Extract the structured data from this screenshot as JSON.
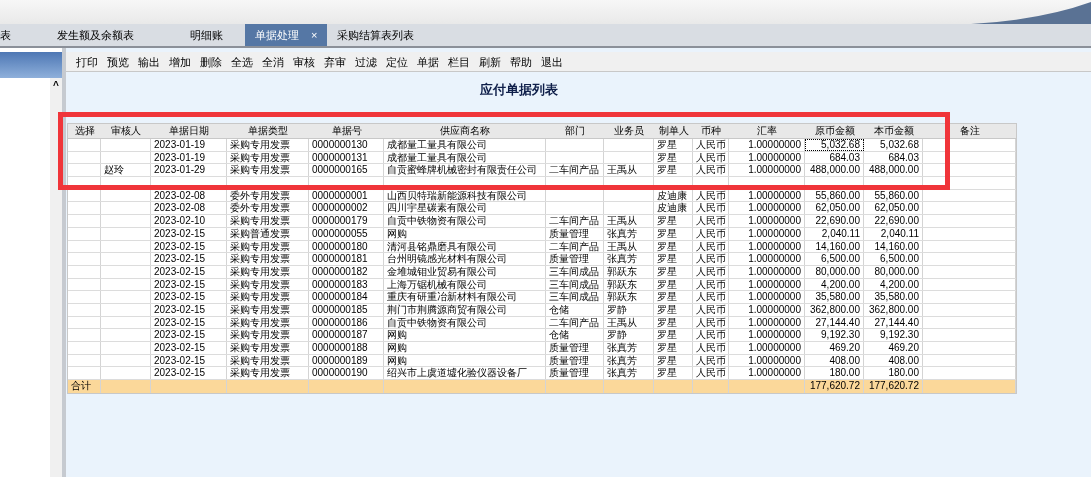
{
  "tabs": [
    {
      "label": "表",
      "selected": false,
      "closable": false
    },
    {
      "label": "发生额及余额表",
      "selected": false,
      "closable": false
    },
    {
      "label": "明细账",
      "selected": false,
      "closable": false
    },
    {
      "label": "单据处理",
      "selected": true,
      "closable": true,
      "close": "×"
    },
    {
      "label": "采购结算表列表",
      "selected": false,
      "closable": false
    }
  ],
  "sidebar": {
    "scroll_up": "^"
  },
  "toolbar": [
    "打印",
    "预览",
    "输出",
    "增加",
    "删除",
    "全选",
    "全消",
    "审核",
    "弃审",
    "过滤",
    "定位",
    "单据",
    "栏目",
    "刷新",
    "帮助",
    "退出"
  ],
  "title": "应付单据列表",
  "table": {
    "columns": [
      "选择",
      "审核人",
      "单据日期",
      "单据类型",
      "单据号",
      "供应商名称",
      "部门",
      "业务员",
      "制单人",
      "币种",
      "汇率",
      "原币金额",
      "本币金额",
      "备注"
    ],
    "rows": [
      {
        "date": "2023-01-19",
        "type": "采购专用发票",
        "number": "0000000130",
        "supplier": "成都量工量具有限公司",
        "creator": "罗星",
        "currency": "人民币",
        "rate": "1.00000000",
        "amount": "5,032.68",
        "local_amount": "5,032.68",
        "focused": true
      },
      {
        "date": "2023-01-19",
        "type": "采购专用发票",
        "number": "0000000131",
        "supplier": "成都量工量具有限公司",
        "creator": "罗星",
        "currency": "人民币",
        "rate": "1.00000000",
        "amount": "684.03",
        "local_amount": "684.03",
        "focused": false
      },
      {
        "reviewer": "赵玲",
        "date": "2023-01-29",
        "type": "采购专用发票",
        "number": "0000000165",
        "supplier": "自贡蜜蜂牌机械密封有限责任公司",
        "department": "二车间产品",
        "salesperson": "王禹从",
        "creator": "罗星",
        "currency": "人民币",
        "rate": "1.00000000",
        "amount": "488,000.00",
        "local_amount": "488,000.00",
        "focused": false
      },
      {
        "focused": false
      },
      {
        "date": "2023-02-08",
        "type": "委外专用发票",
        "number": "0000000001",
        "supplier": "山西贝特瑞新能源科技有限公司",
        "creator": "皮迪康",
        "currency": "人民币",
        "rate": "1.00000000",
        "amount": "55,860.00",
        "local_amount": "55,860.00",
        "focused": false
      },
      {
        "date": "2023-02-08",
        "type": "委外专用发票",
        "number": "0000000002",
        "supplier": "四川宇星碳素有限公司",
        "creator": "皮迪康",
        "currency": "人民币",
        "rate": "1.00000000",
        "amount": "62,050.00",
        "local_amount": "62,050.00",
        "focused": false
      },
      {
        "date": "2023-02-10",
        "type": "采购专用发票",
        "number": "0000000179",
        "supplier": "自贡中铁物资有限公司",
        "department": "二车间产品",
        "salesperson": "王禹从",
        "creator": "罗星",
        "currency": "人民币",
        "rate": "1.00000000",
        "amount": "22,690.00",
        "local_amount": "22,690.00",
        "focused": false
      },
      {
        "date": "2023-02-15",
        "type": "采购普通发票",
        "number": "0000000055",
        "supplier": "网购",
        "department": "质量管理",
        "salesperson": "张真芳",
        "creator": "罗星",
        "currency": "人民币",
        "rate": "1.00000000",
        "amount": "2,040.11",
        "local_amount": "2,040.11",
        "focused": false
      },
      {
        "date": "2023-02-15",
        "type": "采购专用发票",
        "number": "0000000180",
        "supplier": "清河县铭鼎磨具有限公司",
        "department": "二车间产品",
        "salesperson": "王禹从",
        "creator": "罗星",
        "currency": "人民币",
        "rate": "1.00000000",
        "amount": "14,160.00",
        "local_amount": "14,160.00",
        "focused": false
      },
      {
        "date": "2023-02-15",
        "type": "采购专用发票",
        "number": "0000000181",
        "supplier": "台州明镜感光材料有限公司",
        "department": "质量管理",
        "salesperson": "张真芳",
        "creator": "罗星",
        "currency": "人民币",
        "rate": "1.00000000",
        "amount": "6,500.00",
        "local_amount": "6,500.00",
        "focused": false
      },
      {
        "date": "2023-02-15",
        "type": "采购专用发票",
        "number": "0000000182",
        "supplier": "金堆城钼业贸易有限公司",
        "department": "三车间成品",
        "salesperson": "郭跃东",
        "creator": "罗星",
        "currency": "人民币",
        "rate": "1.00000000",
        "amount": "80,000.00",
        "local_amount": "80,000.00",
        "focused": false
      },
      {
        "date": "2023-02-15",
        "type": "采购专用发票",
        "number": "0000000183",
        "supplier": "上海万锯机械有限公司",
        "department": "三车间成品",
        "salesperson": "郭跃东",
        "creator": "罗星",
        "currency": "人民币",
        "rate": "1.00000000",
        "amount": "4,200.00",
        "local_amount": "4,200.00",
        "focused": false
      },
      {
        "date": "2023-02-15",
        "type": "采购专用发票",
        "number": "0000000184",
        "supplier": "重庆有研重冶新材料有限公司",
        "department": "三车间成品",
        "salesperson": "郭跃东",
        "creator": "罗星",
        "currency": "人民币",
        "rate": "1.00000000",
        "amount": "35,580.00",
        "local_amount": "35,580.00",
        "focused": false
      },
      {
        "date": "2023-02-15",
        "type": "采购专用发票",
        "number": "0000000185",
        "supplier": "荆门市荆腾源商贸有限公司",
        "department": "仓储",
        "salesperson": "罗静",
        "creator": "罗星",
        "currency": "人民币",
        "rate": "1.00000000",
        "amount": "362,800.00",
        "local_amount": "362,800.00",
        "focused": false
      },
      {
        "date": "2023-02-15",
        "type": "采购专用发票",
        "number": "0000000186",
        "supplier": "自贡中铁物资有限公司",
        "department": "二车间产品",
        "salesperson": "王禹从",
        "creator": "罗星",
        "currency": "人民币",
        "rate": "1.00000000",
        "amount": "27,144.40",
        "local_amount": "27,144.40",
        "focused": false
      },
      {
        "date": "2023-02-15",
        "type": "采购专用发票",
        "number": "0000000187",
        "supplier": "网购",
        "department": "仓储",
        "salesperson": "罗静",
        "creator": "罗星",
        "currency": "人民币",
        "rate": "1.00000000",
        "amount": "9,192.30",
        "local_amount": "9,192.30",
        "focused": false
      },
      {
        "date": "2023-02-15",
        "type": "采购专用发票",
        "number": "0000000188",
        "supplier": "网购",
        "department": "质量管理",
        "salesperson": "张真芳",
        "creator": "罗星",
        "currency": "人民币",
        "rate": "1.00000000",
        "amount": "469.20",
        "local_amount": "469.20",
        "focused": false
      },
      {
        "date": "2023-02-15",
        "type": "采购专用发票",
        "number": "0000000189",
        "supplier": "网购",
        "department": "质量管理",
        "salesperson": "张真芳",
        "creator": "罗星",
        "currency": "人民币",
        "rate": "1.00000000",
        "amount": "408.00",
        "local_amount": "408.00",
        "focused": false
      },
      {
        "date": "2023-02-15",
        "type": "采购专用发票",
        "number": "0000000190",
        "supplier": "绍兴市上虞道墟化验仪器设备厂",
        "department": "质量管理",
        "salesperson": "张真芳",
        "creator": "罗星",
        "currency": "人民币",
        "rate": "1.00000000",
        "amount": "180.00",
        "local_amount": "180.00",
        "focused": false
      }
    ],
    "total": {
      "select": "合计",
      "amount": "177,620.72",
      "local_amount": "177,620.72"
    }
  }
}
